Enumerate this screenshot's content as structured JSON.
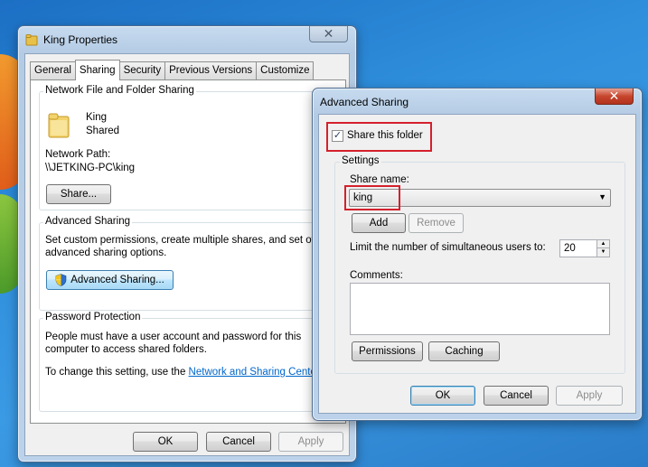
{
  "props_window": {
    "title": "King Properties",
    "tabs": [
      "General",
      "Sharing",
      "Security",
      "Previous Versions",
      "Customize"
    ],
    "network_group": {
      "title": "Network File and Folder Sharing",
      "folder_name": "King",
      "folder_status": "Shared",
      "path_label": "Network Path:",
      "path_value": "\\\\JETKING-PC\\king",
      "share_button": "Share..."
    },
    "advanced_group": {
      "title": "Advanced Sharing",
      "desc_line1": "Set custom permissions, create multiple shares, and set other",
      "desc_line2": "advanced sharing options.",
      "button": "Advanced Sharing..."
    },
    "password_group": {
      "title": "Password Protection",
      "line1": "People must have a user account and password for this",
      "line2": "computer to access shared folders.",
      "line3_prefix": "To change this setting, use the ",
      "link": "Network and Sharing Center",
      "line3_suffix": "."
    },
    "buttons": {
      "ok": "OK",
      "cancel": "Cancel",
      "apply": "Apply"
    }
  },
  "adv_dialog": {
    "title": "Advanced Sharing",
    "share_checkbox_label": "Share this folder",
    "share_checked": true,
    "settings_title": "Settings",
    "share_name_label": "Share name:",
    "share_name_value": "king",
    "add_button": "Add",
    "remove_button": "Remove",
    "limit_label": "Limit the number of simultaneous users to:",
    "limit_value": "20",
    "comments_label": "Comments:",
    "permissions_button": "Permissions",
    "caching_button": "Caching",
    "buttons": {
      "ok": "OK",
      "cancel": "Cancel",
      "apply": "Apply"
    }
  },
  "icons": {
    "close": "close-icon",
    "folder": "folder-icon",
    "shield": "uac-shield-icon",
    "dropdown": "chevron-down-icon"
  },
  "colors": {
    "highlight": "#d4202c",
    "link": "#0066cc"
  }
}
